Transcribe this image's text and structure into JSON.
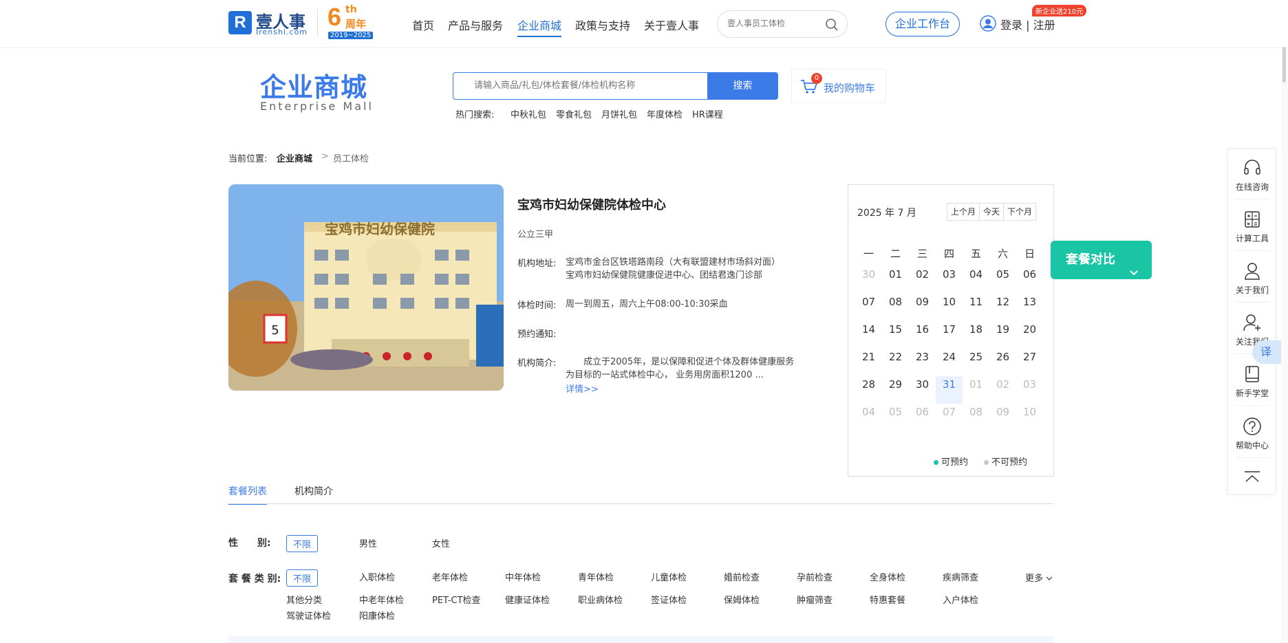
{
  "header": {
    "logo_mark": "R",
    "logo_text": "壹人事",
    "logo_sub": "Irenshi.com",
    "anniv_num": "6",
    "anniv_th": "th",
    "anniv_cn": "周年",
    "anniv_years": "2019~2025",
    "nav": [
      "首页",
      "产品与服务",
      "企业商城",
      "政策与支持",
      "关于壹人事"
    ],
    "nav_active": 2,
    "search_placeholder": "壹人事员工体检",
    "workbench": "企业工作台",
    "login": "登录 | 注册",
    "promo": "新企业送210元"
  },
  "mall": {
    "title": "企业商城",
    "subtitle": "Enterprise Mall",
    "search_placeholder": "请输入商品/礼包/体检套餐/体检机构名称",
    "search_button": "搜索",
    "cart_label": "我的购物车",
    "cart_count": "0",
    "hot_label": "热门搜索:",
    "hot_items": [
      "中秋礼包",
      "零食礼包",
      "月饼礼包",
      "年度体检",
      "HR课程"
    ]
  },
  "breadcrumb": {
    "prefix": "当前位置:",
    "level1": "企业商城",
    "sep": ">",
    "level2": "员工体检"
  },
  "institution": {
    "name": "宝鸡市妇幼保健院体检中心",
    "level": "公立三甲",
    "address_key": "机构地址:",
    "address_line1": "宝鸡市金台区铁塔路南段（大有联盟建材市场斜对面）",
    "address_line2": "宝鸡市妇幼保健院健康促进中心、团结君逸门诊部",
    "time_key": "体检时间:",
    "time_val": "周一到周五，周六上午08:00-10:30采血",
    "notice_key": "预约通知:",
    "notice_val": "",
    "intro_key": "机构简介:",
    "intro_val": "　　成立于2005年，是以保障和促进个体及群体健康服务为目标的一站式体检中心， 业务用房面积1200 ...",
    "more": "详情>>",
    "image_sign": "宝鸡市妇幼保健院"
  },
  "calendar": {
    "month_label": "2025 年 7 月",
    "buttons": [
      "上个月",
      "今天",
      "下个月"
    ],
    "weekdays": [
      "一",
      "二",
      "三",
      "四",
      "五",
      "六",
      "日"
    ],
    "weeks": [
      [
        {
          "d": "30",
          "m": true
        },
        {
          "d": "01"
        },
        {
          "d": "02"
        },
        {
          "d": "03"
        },
        {
          "d": "04"
        },
        {
          "d": "05"
        },
        {
          "d": "06"
        }
      ],
      [
        {
          "d": "07"
        },
        {
          "d": "08"
        },
        {
          "d": "09"
        },
        {
          "d": "10"
        },
        {
          "d": "11"
        },
        {
          "d": "12"
        },
        {
          "d": "13"
        }
      ],
      [
        {
          "d": "14"
        },
        {
          "d": "15"
        },
        {
          "d": "16"
        },
        {
          "d": "17"
        },
        {
          "d": "18"
        },
        {
          "d": "19"
        },
        {
          "d": "20"
        }
      ],
      [
        {
          "d": "21"
        },
        {
          "d": "22"
        },
        {
          "d": "23"
        },
        {
          "d": "24"
        },
        {
          "d": "25"
        },
        {
          "d": "26"
        },
        {
          "d": "27"
        }
      ],
      [
        {
          "d": "28"
        },
        {
          "d": "29"
        },
        {
          "d": "30"
        },
        {
          "d": "31",
          "t": true
        },
        {
          "d": "01",
          "m": true
        },
        {
          "d": "02",
          "m": true
        },
        {
          "d": "03",
          "m": true
        }
      ],
      [
        {
          "d": "04",
          "m": true
        },
        {
          "d": "05",
          "m": true
        },
        {
          "d": "06",
          "m": true
        },
        {
          "d": "07",
          "m": true
        },
        {
          "d": "08",
          "m": true
        },
        {
          "d": "09",
          "m": true
        },
        {
          "d": "10",
          "m": true
        }
      ]
    ],
    "legend_available": "可预约",
    "legend_unavailable": "不可预约",
    "color_available": "#19c5a4",
    "color_unavailable": "#c8c8c8"
  },
  "compare_button": "套餐对比",
  "right_rail": [
    {
      "label": "在线咨询",
      "icon": "headset-icon"
    },
    {
      "label": "计算工具",
      "icon": "calculator-icon"
    },
    {
      "label": "关于我们",
      "icon": "person-icon"
    },
    {
      "label": "关注我们",
      "icon": "add-user-icon"
    },
    {
      "label": "新手学堂",
      "icon": "book-icon"
    },
    {
      "label": "帮助中心",
      "icon": "help-icon"
    }
  ],
  "translate_label": "译",
  "tabs": [
    "套餐列表",
    "机构简介"
  ],
  "filters": {
    "gender_label": "性　　别:",
    "gender_options": [
      "不限",
      "男性",
      "女性"
    ],
    "type_label": "套 餐 类 别:",
    "type_options_row1": [
      "不限",
      "入职体检",
      "老年体检",
      "中年体检",
      "青年体检",
      "儿童体检",
      "婚前检查",
      "孕前检查",
      "全身体检",
      "疾病筛查"
    ],
    "type_options_row2": [
      "其他分类",
      "中老年体检",
      "PET-CT检查",
      "健康证体检",
      "职业病体检",
      "签证体检",
      "保姆体检",
      "肿瘤筛查",
      "特惠套餐",
      "入户体检"
    ],
    "type_options_row3": [
      "驾驶证体检",
      "阳康体检"
    ],
    "more": "更多"
  },
  "colors": {
    "brand": "#3b7be8",
    "accent": "#19c5a4",
    "orange": "#f08a1c",
    "red": "#f0432e"
  }
}
